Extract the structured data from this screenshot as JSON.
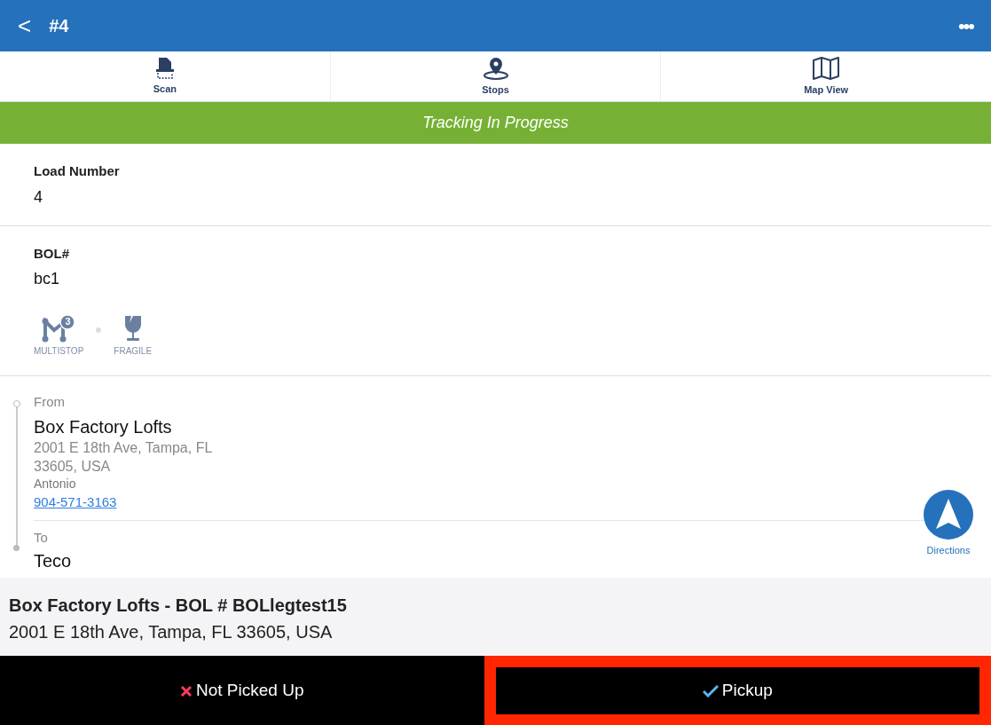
{
  "header": {
    "back": "<",
    "title": "#4",
    "menu": "•••"
  },
  "tabs": [
    {
      "label": "Scan",
      "kind": "scan"
    },
    {
      "label": "Stops",
      "kind": "stops"
    },
    {
      "label": "Map View",
      "kind": "map"
    }
  ],
  "status_banner": "Tracking In Progress",
  "fields": [
    {
      "label": "Load Number",
      "value": "4"
    },
    {
      "label": "BOL#",
      "value": "bc1"
    }
  ],
  "tags": [
    {
      "label": "MULTISTOP",
      "kind": "multistop",
      "count": "3"
    },
    {
      "label": "FRAGILE",
      "kind": "fragile"
    }
  ],
  "route": {
    "from_label": "From",
    "from_name": "Box Factory Lofts",
    "from_address": "2001 E 18th Ave, Tampa, FL 33605, USA",
    "contact": "Antonio",
    "phone": "904-571-3163",
    "to_label": "To",
    "to_name": "Teco"
  },
  "directions": "Directions",
  "current_stop": {
    "title": "Box Factory Lofts - BOL # BOLlegtest15",
    "address": "2001 E 18th Ave, Tampa, FL 33605, USA"
  },
  "actions": [
    {
      "label": "Not Picked Up",
      "kind": "reject",
      "highlighted": false
    },
    {
      "label": "Pickup",
      "kind": "accept",
      "highlighted": true
    }
  ]
}
